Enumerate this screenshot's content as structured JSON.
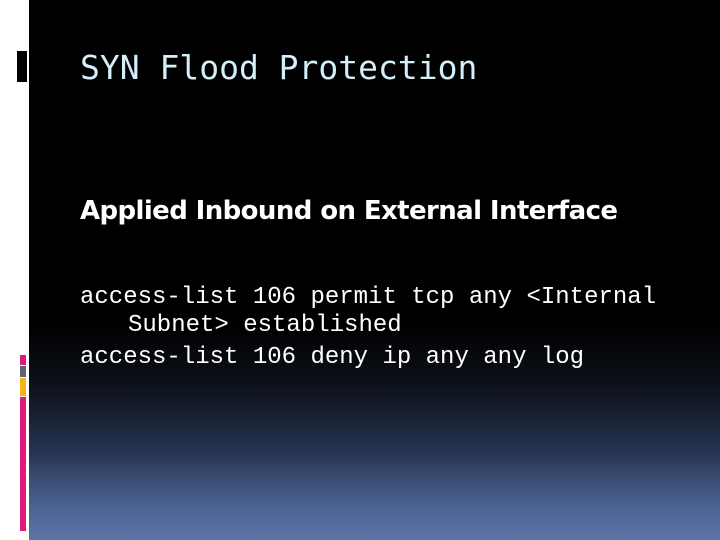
{
  "slide": {
    "title": "SYN Flood Protection",
    "subtitle": "Applied Inbound on External Interface",
    "code_lines": [
      "access-list 106 permit tcp any <Internal",
      "Subnet> established",
      "access-list 106 deny ip any any log"
    ]
  },
  "theme": {
    "title_color": "#d4eefa",
    "accent_colors": [
      "#e0197d",
      "#5a6470",
      "#f6b31a",
      "#e0197d"
    ],
    "background_top": "#000000",
    "background_bottom": "#5b75a8"
  }
}
